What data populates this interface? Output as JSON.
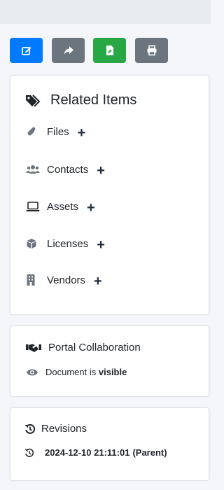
{
  "toolbar": {
    "buttons": [
      {
        "name": "edit",
        "icon": "edit-icon",
        "color": "#007bff"
      },
      {
        "name": "share",
        "icon": "share-icon",
        "color": "#6c757d"
      },
      {
        "name": "export-pdf",
        "icon": "file-pdf-icon",
        "color": "#28a745"
      },
      {
        "name": "print",
        "icon": "print-icon",
        "color": "#6c757d"
      }
    ]
  },
  "related": {
    "title": "Related Items",
    "add_symbol": "+",
    "items": [
      {
        "label": "Files",
        "icon": "paperclip-icon"
      },
      {
        "label": "Contacts",
        "icon": "users-icon"
      },
      {
        "label": "Assets",
        "icon": "laptop-icon"
      },
      {
        "label": "Licenses",
        "icon": "cube-icon"
      },
      {
        "label": "Vendors",
        "icon": "building-icon"
      }
    ]
  },
  "portal": {
    "title": "Portal Collaboration",
    "visibility_prefix": "Document is",
    "visibility_value": "visible"
  },
  "revisions": {
    "title": "Revisions",
    "items": [
      {
        "date": "2024-12-10 21:11:01",
        "tag": "(Parent)"
      }
    ]
  }
}
